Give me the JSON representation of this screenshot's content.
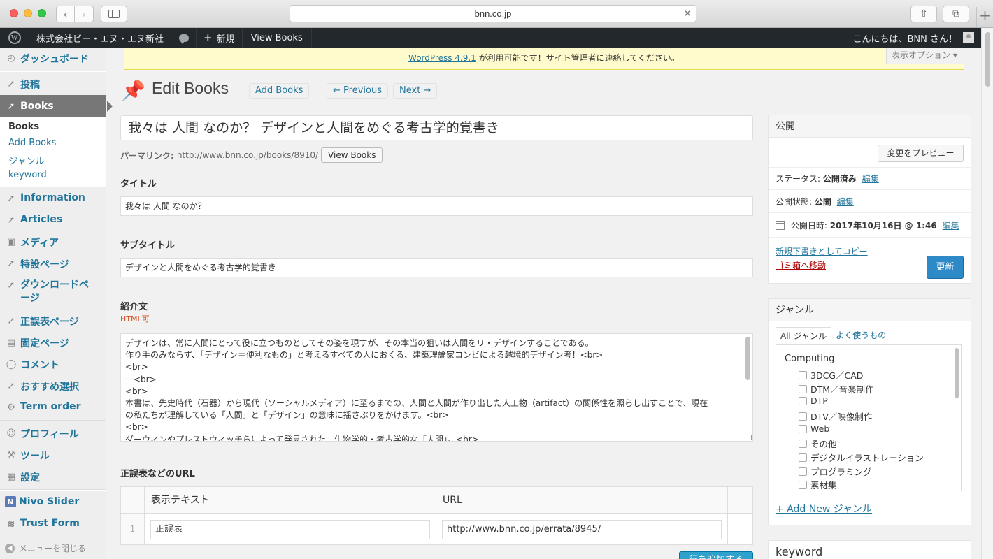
{
  "browser": {
    "address": "bnn.co.jp"
  },
  "adminbar": {
    "site_name": "株式会社ビー・エヌ・エヌ新社",
    "new_label": "新規",
    "view_books": "View Books",
    "greeting": "こんにちは、BNN さん！"
  },
  "menu": {
    "items": [
      {
        "label": "ダッシュボード",
        "icon": "dashboard-icon"
      },
      {
        "label": "投稿",
        "icon": "pin-icon"
      },
      {
        "label": "Books",
        "icon": "pin-icon"
      },
      {
        "label": "Information",
        "icon": "pin-icon"
      },
      {
        "label": "Articles",
        "icon": "pin-icon"
      },
      {
        "label": "メディア",
        "icon": "media-icon"
      },
      {
        "label": "特設ページ",
        "icon": "pin-icon"
      },
      {
        "label": "ダウンロードページ",
        "icon": "pin-icon"
      },
      {
        "label": "正誤表ページ",
        "icon": "pin-icon"
      },
      {
        "label": "固定ページ",
        "icon": "page-icon"
      },
      {
        "label": "コメント",
        "icon": "comment-icon"
      },
      {
        "label": "おすすめ選択",
        "icon": "pin-icon"
      },
      {
        "label": "Term order",
        "icon": "gear-icon"
      },
      {
        "label": "プロフィール",
        "icon": "users-icon"
      },
      {
        "label": "ツール",
        "icon": "tools-icon"
      },
      {
        "label": "設定",
        "icon": "settings-icon"
      },
      {
        "label": "Nivo Slider",
        "icon": "nivo-icon"
      },
      {
        "label": "Trust Form",
        "icon": "form-icon"
      }
    ],
    "submenu": [
      "Books",
      "Add Books",
      "ジャンル",
      "keyword"
    ],
    "collapse": "メニューを閉じる"
  },
  "notice": {
    "link": "WordPress 4.9.1",
    "text": " が利用可能です！サイト管理者に連絡してください。"
  },
  "screen_options": "表示オプション ▾",
  "header": {
    "title": "Edit Books",
    "add_button": "Add Books",
    "prev_button": "← Previous",
    "next_button": "Next →"
  },
  "post": {
    "title": "我々は 人間 なのか？ デザインと人間をめぐる考古学的覚書き",
    "permalink_label": "パーマリンク:",
    "permalink_url": "http://www.bnn.co.jp/books/8910/",
    "view_button": "View Books"
  },
  "fields": {
    "title_label": "タイトル",
    "title_value": "我々は 人間 なのか？",
    "subtitle_label": "サブタイトル",
    "subtitle_value": "デザインと人間をめぐる考古学的覚書き",
    "intro_label": "紹介文",
    "intro_note": "HTML可",
    "intro_lines": [
      "デザインは、常に人間にとって役に立つものとしてその姿を現すが、その本当の狙いは人間をリ・デザインすることである。",
      "作り手のみならず、「デザイン＝便利なもの」と考えるすべての人におくる、建築理論家コンビによる越境的デザイン考！<br>",
      "<br>",
      "ー<br>",
      "<br>",
      "本書は、先史時代（石器）から現代（ソーシャルメディア）に至るまでの、人間と人間が作り出した人工物（artifact）の関係性を照らし出すことで、現在",
      "の私たちが理解している「人間」と「デザイン」の意味に揺さぶりをかけます。<br>",
      "<br>",
      "ダーウィンやプレストウィッチらによって発見された、生物学的・考古学的な「人間」。<br>"
    ],
    "errata_label": "正誤表などのURL"
  },
  "repeater": {
    "col_text": "表示テキスト",
    "col_url": "URL",
    "rows": [
      {
        "num": "1",
        "text": "正誤表",
        "url": "http://www.bnn.co.jp/errata/8945/"
      }
    ],
    "add_row": "行を追加する"
  },
  "publish": {
    "heading": "公開",
    "preview": "変更をプレビュー",
    "status_label": "ステータス:",
    "status_value": "公開済み",
    "visibility_label": "公開状態:",
    "visibility_value": "公開",
    "date_label": "公開日時:",
    "date_value": "2017年10月16日 @ 1:46",
    "edit": "編集",
    "copy_draft": "新規下書きとしてコピー",
    "trash": "ゴミ箱へ移動",
    "update": "更新"
  },
  "genre": {
    "heading": "ジャンル",
    "tab_all": "All ジャンル",
    "tab_popular": "よく使うもの",
    "parent": "Computing",
    "items": [
      "3DCG／CAD",
      "DTM／音楽制作",
      "DTP",
      "DTV／映像制作",
      "Web",
      "その他",
      "デジタルイラストレーション",
      "プログラミング",
      "素材集"
    ],
    "add_new": "+ Add New ジャンル"
  },
  "keyword": {
    "heading": "keyword"
  },
  "colors": {
    "link": "#21759b",
    "adminbar": "#23282d",
    "active_menu": "#777777",
    "primary_button": "#2e8ac7",
    "notice_bg": "#fffbcc",
    "trash": "#aa0000"
  }
}
